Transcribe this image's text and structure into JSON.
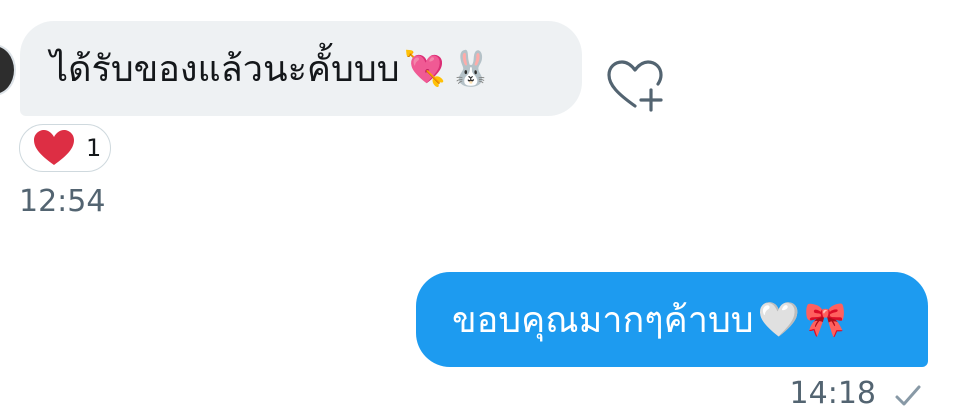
{
  "conversation": {
    "incoming": {
      "text": "ได้รับของแล้วนะคั้บบบ",
      "emoji_1": "💘",
      "emoji_2": "🐰",
      "emoji_1_icon": "heart-with-arrow-icon",
      "emoji_2_icon": "rabbit-face-icon",
      "reaction": {
        "emoji": "❤️",
        "icon": "red-heart-icon",
        "count": "1"
      },
      "time": "12:54",
      "bubble_color": "#eef1f3"
    },
    "outgoing": {
      "text": "ขอบคุณมากๆค้าบบ",
      "emoji_1": "🤍",
      "emoji_2": "🎀",
      "emoji_1_icon": "white-heart-icon",
      "emoji_2_icon": "ribbon-icon",
      "time": "14:18",
      "status_icon": "sent-checkmark-icon",
      "bubble_color": "#1d9bf0"
    },
    "add_reaction_icon": "heart-plus-icon"
  }
}
